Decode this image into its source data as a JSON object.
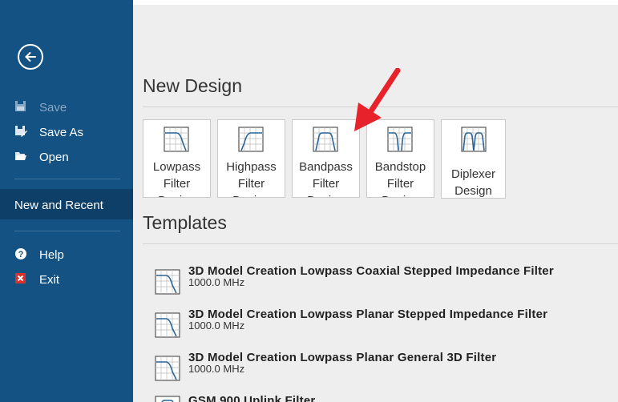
{
  "sidebar": {
    "back_label": "Back",
    "items": [
      {
        "label": "Save",
        "icon": "floppy-icon",
        "enabled": false
      },
      {
        "label": "Save As",
        "icon": "save-as-icon",
        "enabled": true
      },
      {
        "label": "Open",
        "icon": "folder-open-icon",
        "enabled": true
      }
    ],
    "selected": "New and Recent",
    "bottom_items": [
      {
        "label": "Help",
        "icon": "help-icon"
      },
      {
        "label": "Exit",
        "icon": "close-icon"
      }
    ]
  },
  "main": {
    "new_design_heading": "New Design",
    "tiles": [
      {
        "label": "Lowpass\nFilter\nDesign",
        "icon": "lowpass-icon"
      },
      {
        "label": "Highpass\nFilter\nDesign",
        "icon": "highpass-icon"
      },
      {
        "label": "Bandpass\nFilter\nDesign",
        "icon": "bandpass-icon"
      },
      {
        "label": "Bandstop\nFilter\nDesign",
        "icon": "bandstop-icon"
      },
      {
        "label": "Diplexer\nDesign",
        "icon": "diplexer-icon"
      }
    ],
    "templates_heading": "Templates",
    "templates": [
      {
        "title": "3D Model Creation Lowpass Coaxial Stepped Impedance Filter",
        "subtitle": "1000.0 MHz",
        "icon": "lowpass-icon"
      },
      {
        "title": "3D Model Creation Lowpass Planar Stepped Impedance Filter",
        "subtitle": "1000.0 MHz",
        "icon": "lowpass-icon"
      },
      {
        "title": "3D Model Creation Lowpass Planar General 3D Filter",
        "subtitle": "1000.0 MHz",
        "icon": "lowpass-icon"
      },
      {
        "title": "GSM 900 Uplink Filter",
        "subtitle": "",
        "icon": "bandpass-icon"
      }
    ]
  },
  "colors": {
    "sidebar_bg": "#135283",
    "sidebar_selected": "#0e3f68",
    "annotation_arrow": "#e8222a",
    "curve_blue": "#2a6496"
  }
}
